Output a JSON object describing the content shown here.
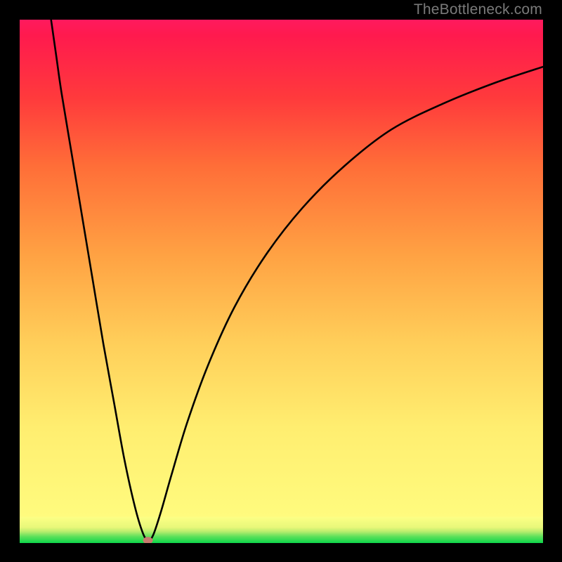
{
  "watermark": "TheBottleneck.com",
  "chart_data": {
    "type": "line",
    "title": "",
    "xlabel": "",
    "ylabel": "",
    "xlim": [
      0,
      100
    ],
    "ylim": [
      0,
      100
    ],
    "grid": false,
    "series": [
      {
        "name": "curve",
        "x": [
          6,
          7,
          8,
          10,
          12,
          14,
          16,
          18,
          20,
          22,
          23.5,
          24.5,
          25.5,
          27,
          29,
          32,
          36,
          41,
          47,
          54,
          62,
          71,
          81,
          91,
          100
        ],
        "y": [
          100,
          93,
          86,
          74,
          62,
          50,
          38,
          27,
          16,
          7,
          2,
          0.5,
          1.5,
          6,
          13,
          23,
          34,
          45,
          55,
          64,
          72,
          79,
          84,
          88,
          91
        ]
      }
    ],
    "marker": {
      "x": 24.5,
      "y": 0.5,
      "color": "#c97a6e"
    },
    "gradient_bands": [
      {
        "from_y": 0,
        "to_y": 3,
        "color": "#0dd64a"
      },
      {
        "from_y": 3,
        "to_y": 6,
        "color": "#e8f87a"
      },
      {
        "from_y": 6,
        "to_y": 45,
        "color": "#ffff82"
      },
      {
        "from_y": 45,
        "to_y": 75,
        "color": "#ff8a3e"
      },
      {
        "from_y": 75,
        "to_y": 100,
        "color": "#ff1a4e"
      }
    ]
  }
}
